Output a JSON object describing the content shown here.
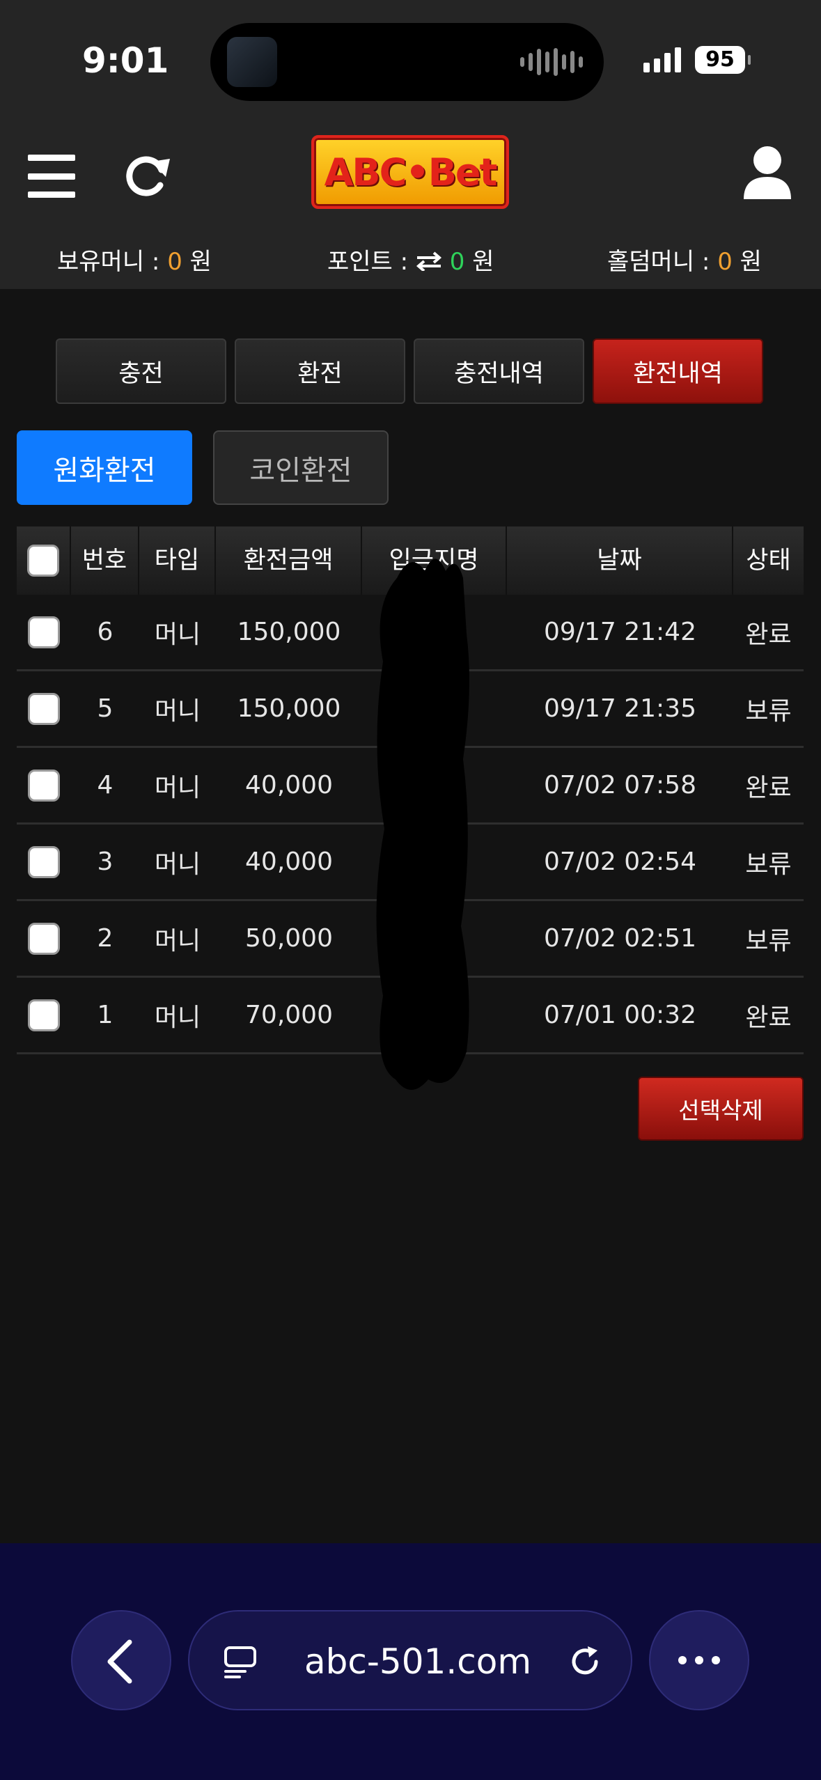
{
  "status_bar": {
    "time": "9:01",
    "battery": "95",
    "icons": [
      "signal-icon",
      "battery-icon",
      "dynamic-island-waveform-icon"
    ]
  },
  "header": {
    "logo_text": "ABC•Bet",
    "icons": [
      "hamburger-menu-icon",
      "refresh-icon",
      "user-icon"
    ],
    "balances": [
      {
        "label": "보유머니 :",
        "value": "0",
        "unit": "원"
      },
      {
        "label": "포인트 :",
        "icon": "exchange-arrows-icon",
        "value": "0",
        "unit": "원"
      },
      {
        "label": "홀덤머니 :",
        "value": "0",
        "unit": "원"
      }
    ]
  },
  "tabs": [
    {
      "label": "충전",
      "active": false
    },
    {
      "label": "환전",
      "active": false
    },
    {
      "label": "충전내역",
      "active": false
    },
    {
      "label": "환전내역",
      "active": true
    }
  ],
  "subtabs": [
    {
      "label": "원화환전",
      "active": true
    },
    {
      "label": "코인환전",
      "active": false
    }
  ],
  "table": {
    "headers": [
      "번호",
      "타입",
      "환전금액",
      "입금지명",
      "날짜",
      "상태"
    ],
    "rows": [
      {
        "no": "6",
        "type": "머니",
        "amount": "150,000",
        "date": "09/17 21:42",
        "status": "완료"
      },
      {
        "no": "5",
        "type": "머니",
        "amount": "150,000",
        "date": "09/17 21:35",
        "status": "보류"
      },
      {
        "no": "4",
        "type": "머니",
        "amount": "40,000",
        "date": "07/02 07:58",
        "status": "완료"
      },
      {
        "no": "3",
        "type": "머니",
        "amount": "40,000",
        "date": "07/02 02:54",
        "status": "보류"
      },
      {
        "no": "2",
        "type": "머니",
        "amount": "50,000",
        "date": "07/02 02:51",
        "status": "보류"
      },
      {
        "no": "1",
        "type": "머니",
        "amount": "70,000",
        "date": "07/01 00:32",
        "status": "완료"
      }
    ]
  },
  "delete_button": "선택삭제",
  "browser": {
    "url": "abc-501.com",
    "icons": [
      "back-chevron-icon",
      "tabs-icon",
      "reload-icon",
      "more-dots-icon"
    ]
  },
  "colors": {
    "accent_red": "#c6231c",
    "accent_blue": "#0f7bff",
    "amount_orange": "#f0a030",
    "point_green": "#2ed25a",
    "browser_bar": "#0c0a3a"
  }
}
